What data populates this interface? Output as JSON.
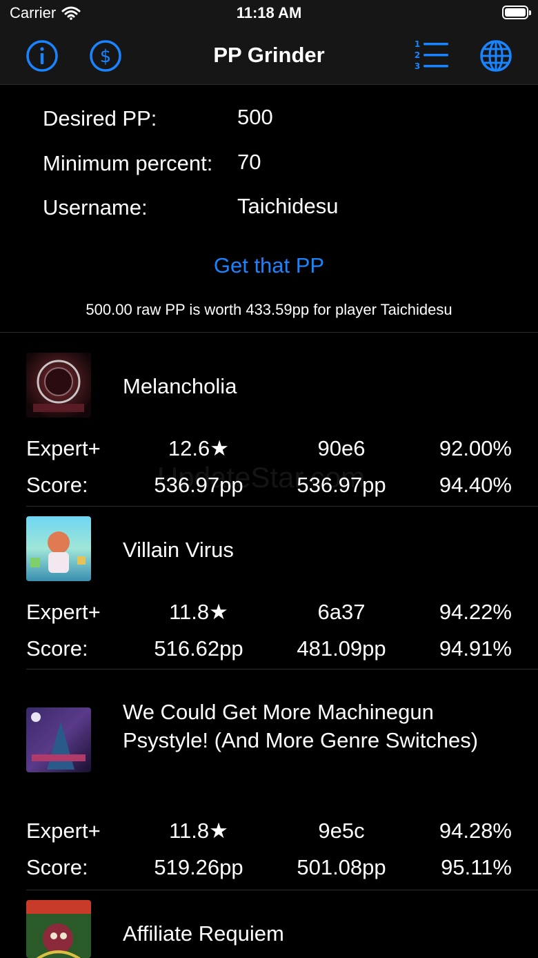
{
  "status": {
    "carrier": "Carrier",
    "time": "11:18 AM"
  },
  "nav": {
    "title": "PP Grinder"
  },
  "form": {
    "desired_label": "Desired PP:",
    "desired_value": "500",
    "percent_label": "Minimum percent:",
    "percent_value": "70",
    "username_label": "Username:",
    "username_value": "Taichidesu",
    "cta": "Get that PP",
    "summary": "500.00 raw PP is worth 433.59pp for player Taichidesu"
  },
  "watermark": "UpdateStar.com",
  "songs": [
    {
      "title": "Melancholia",
      "difficulty": "Expert+",
      "stars": "12.6★",
      "hash": "90e6",
      "accuracy": "92.00%",
      "score_label": "Score:",
      "raw_pp": "536.97pp",
      "weighted_pp": "536.97pp",
      "score_pct": "94.40%"
    },
    {
      "title": "Villain Virus",
      "difficulty": "Expert+",
      "stars": "11.8★",
      "hash": "6a37",
      "accuracy": "94.22%",
      "score_label": "Score:",
      "raw_pp": "516.62pp",
      "weighted_pp": "481.09pp",
      "score_pct": "94.91%"
    },
    {
      "title": "We Could Get More Machinegun Psystyle! (And More Genre Switches)",
      "difficulty": "Expert+",
      "stars": "11.8★",
      "hash": "9e5c",
      "accuracy": "94.28%",
      "score_label": "Score:",
      "raw_pp": "519.26pp",
      "weighted_pp": "501.08pp",
      "score_pct": "95.11%"
    },
    {
      "title": "Affiliate Requiem"
    }
  ],
  "colors": {
    "accent": "#1a84ff",
    "background": "#000000",
    "bar": "#161616"
  }
}
